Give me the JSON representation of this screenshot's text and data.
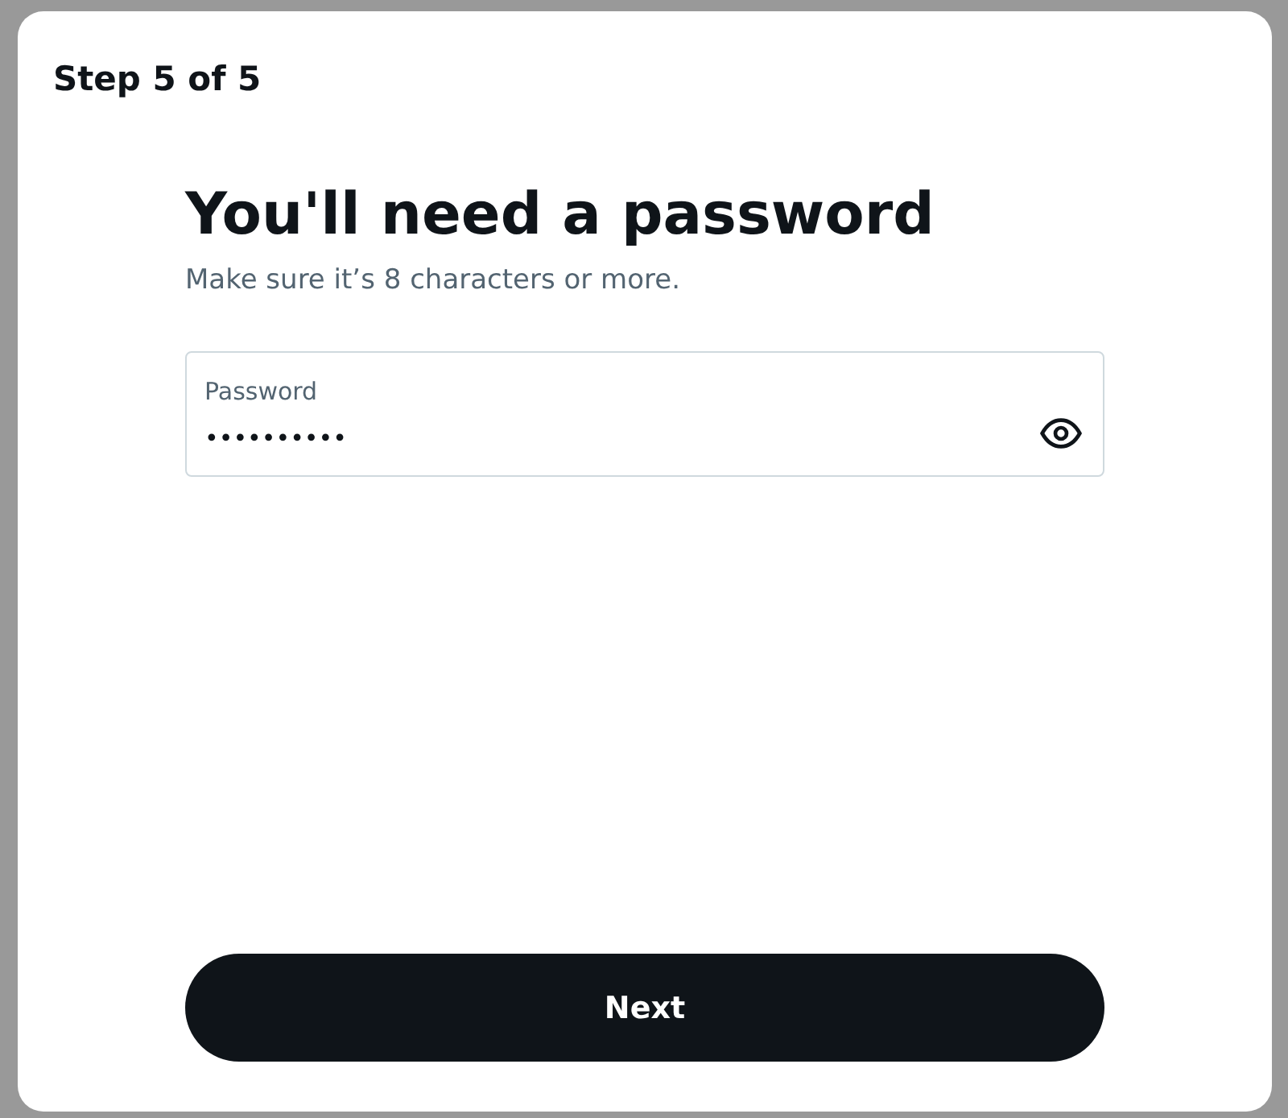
{
  "header": {
    "step": "Step 5 of 5"
  },
  "title": "You'll need a password",
  "subtitle": "Make sure it’s 8 characters or more.",
  "password_field": {
    "label": "Password",
    "value": "••••••••••",
    "reveal": false
  },
  "buttons": [
    {
      "label": "Next",
      "kind": "primary"
    }
  ]
}
